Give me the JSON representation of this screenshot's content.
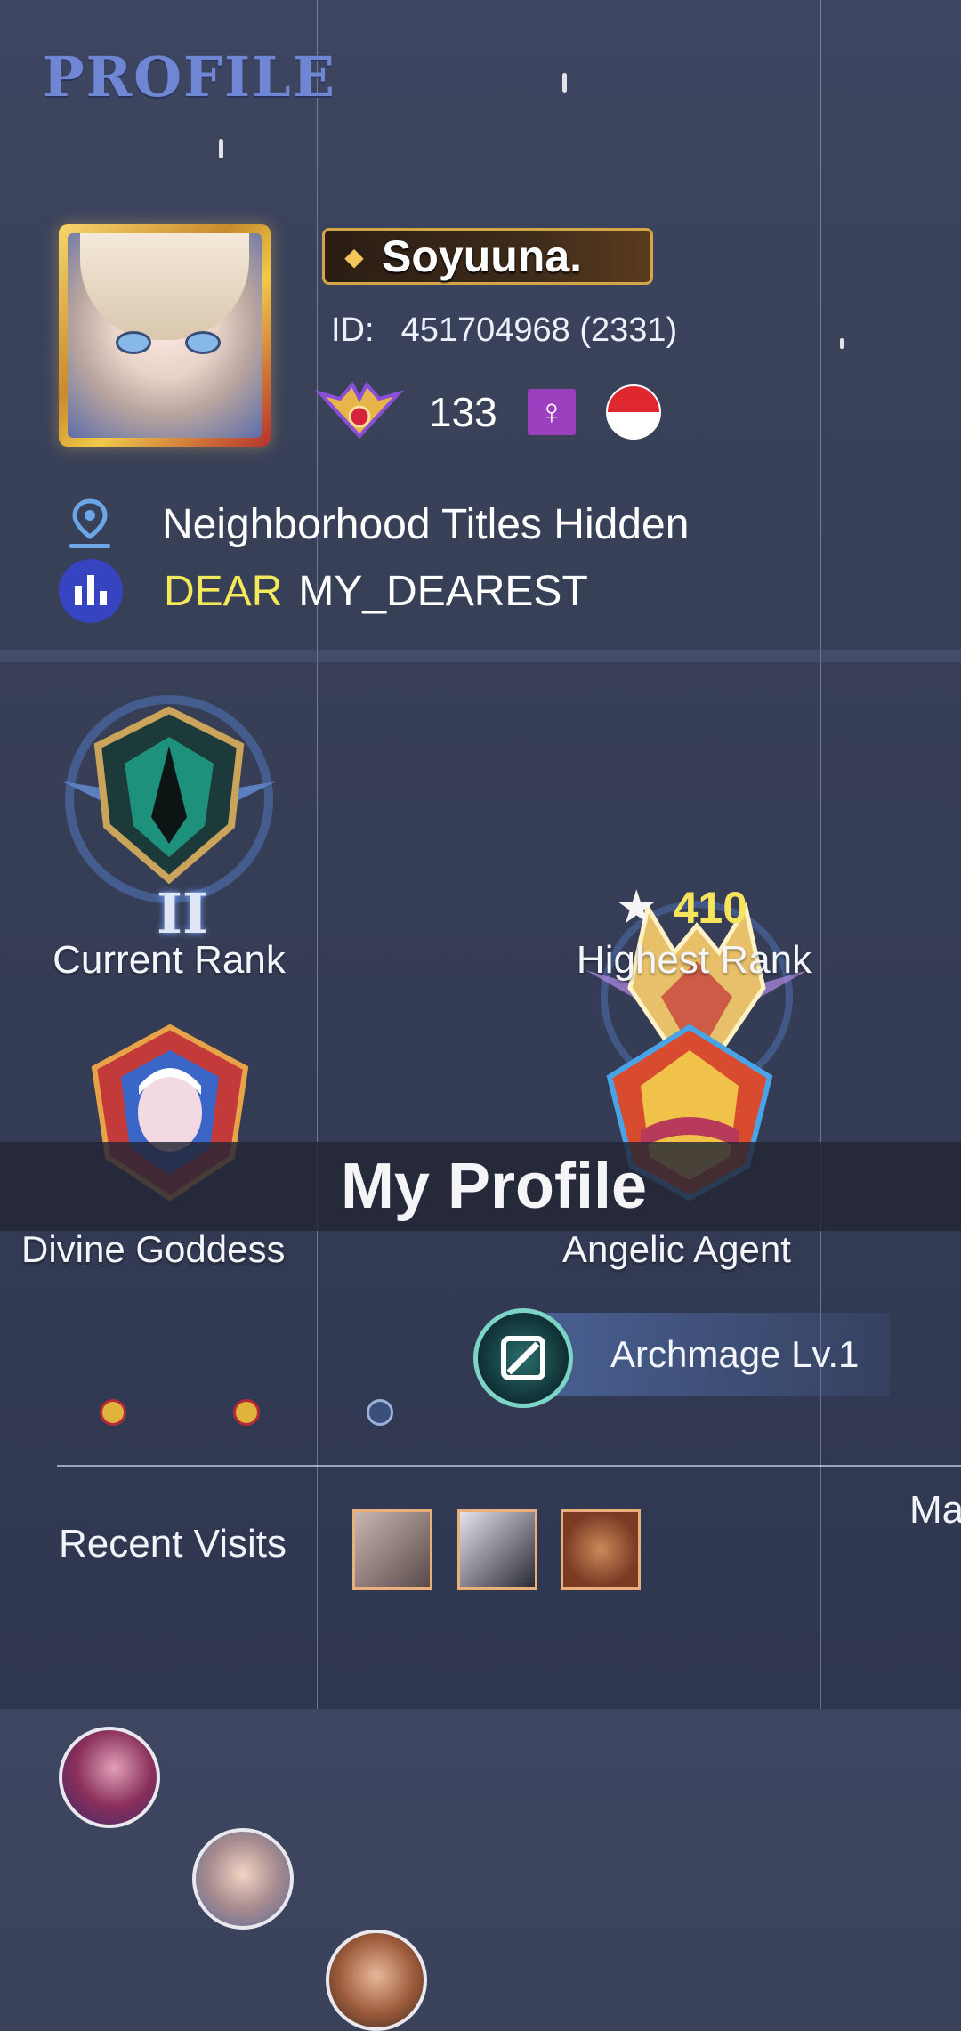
{
  "page": {
    "title": "PROFILE",
    "banner": "My Profile"
  },
  "player": {
    "name": "Soyuuna.",
    "id_label": "ID:",
    "id_value": "451704968 (2331)",
    "level": "133",
    "gender_icon": "female-icon",
    "flag_icon": "indonesia-flag-icon"
  },
  "info": {
    "location": "Neighborhood Titles Hidden",
    "title_prefix": "DEAR",
    "title_name": "MY_DEAREST"
  },
  "ranks": {
    "current_label": "Current Rank",
    "current_tier": "II",
    "highest_label": "Highest Rank",
    "highest_stars": "410"
  },
  "achievements": {
    "left_label": "Divine Goddess",
    "right_label": "Angelic Agent"
  },
  "badge": {
    "label": "Archmage Lv.1"
  },
  "visits": {
    "label": "Recent Visits",
    "edge_text": "Ma"
  },
  "colors": {
    "title": "#6f86d4",
    "highlight_yellow": "#f3e95a",
    "gender_bg": "#9b3fbf",
    "stats_badge": "#3744c2"
  }
}
